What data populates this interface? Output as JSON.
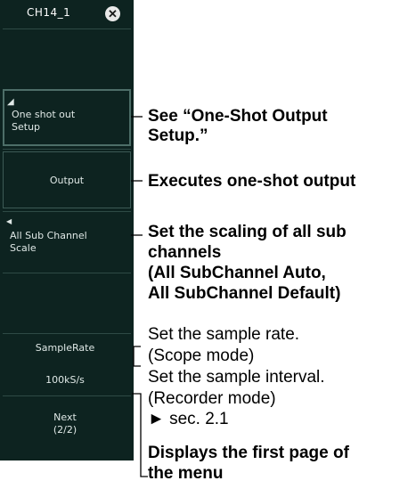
{
  "panel": {
    "title": "CH14_1",
    "close_glyph": "✕",
    "one_shot_setup": {
      "line1": "One shot out",
      "line2": "Setup"
    },
    "output_label": "Output",
    "all_sub_channel_scale": {
      "line1": "All Sub Channel",
      "line2": "Scale"
    },
    "sample_rate_label": "SampleRate",
    "sample_rate_value": "100kS/s",
    "next": {
      "line1": "Next",
      "line2": "(2/2)"
    }
  },
  "annotations": {
    "one_shot": {
      "line1": "See “One-Shot Output",
      "line2": "Setup.”"
    },
    "output": "Executes one-shot output",
    "scale": {
      "line1": "Set the scaling of all sub",
      "line2": "channels",
      "line3": "(All SubChannel Auto,",
      "line4": "All SubChannel Default)"
    },
    "sample": {
      "line1": "Set the sample rate.",
      "line2": "(Scope mode)",
      "line3": "Set the sample interval.",
      "line4": "(Recorder mode)",
      "line5": "► sec. 2.1"
    },
    "next": {
      "line1": "Displays the first page of",
      "line2": "the menu"
    }
  }
}
